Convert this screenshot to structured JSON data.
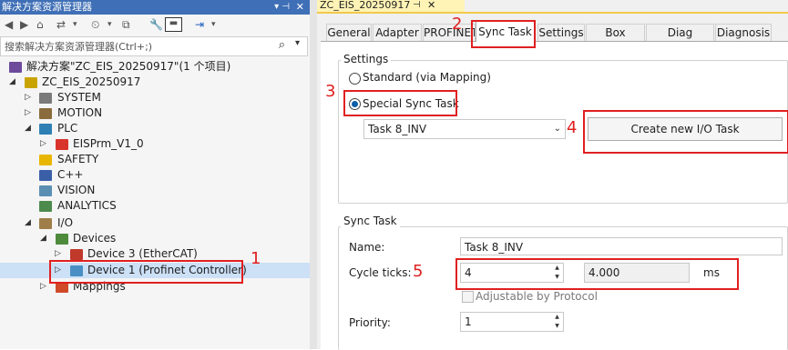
{
  "left_panel": {
    "title": "解决方案资源管理器",
    "pin_glyph": "▾ ⊣",
    "close_glyph": "✕",
    "search_placeholder": "搜索解决方案资源管理器(Ctrl+;)",
    "tree": {
      "solution": "解决方案\"ZC_EIS_20250917\"(1 个项目)",
      "project": "ZC_EIS_20250917",
      "nodes": {
        "system": "SYSTEM",
        "motion": "MOTION",
        "plc": "PLC",
        "eisprm": "EISPrm_V1_0",
        "safety": "SAFETY",
        "cpp": "C++",
        "vision": "VISION",
        "analytics": "ANALYTICS",
        "io": "I/O",
        "devices": "Devices",
        "device3": "Device 3 (EtherCAT)",
        "device1": "Device 1 (Profinet Controller)",
        "mappings": "Mappings"
      }
    }
  },
  "right_panel": {
    "doc_tab": {
      "title": "ZC_EIS_20250917",
      "pin": "⊣",
      "close": "✕"
    },
    "tabs": [
      "General",
      "Adapter",
      "PROFINET",
      "Sync Task",
      "Settings",
      "Box States",
      "Diag History",
      "Diagnosis"
    ],
    "active_tab": "Sync Task",
    "settings_group": {
      "label": "Settings",
      "radio_standard": "Standard (via Mapping)",
      "radio_special": "Special Sync Task",
      "selected": "Special Sync Task",
      "task_select_value": "Task 8_INV",
      "create_button": "Create new I/O Task"
    },
    "sync_task_group": {
      "label": "Sync Task",
      "name_label": "Name:",
      "name_value": "Task 8_INV",
      "cycle_label": "Cycle ticks:",
      "cycle_value": "4",
      "cycle_ms_value": "4.000",
      "ms_unit": "ms",
      "adjustable_label": "Adjustable by Protocol",
      "priority_label": "Priority:",
      "priority_value": "1"
    }
  },
  "annotations": {
    "step1": "1",
    "step2": "2",
    "step3": "3",
    "step4": "4",
    "step5": "5"
  },
  "colors": {
    "annotation_red": "#e02020",
    "title_blue": "#3f6fb6",
    "selection": "#cce0f6",
    "doc_tab_yellow": "#fff3b5"
  }
}
